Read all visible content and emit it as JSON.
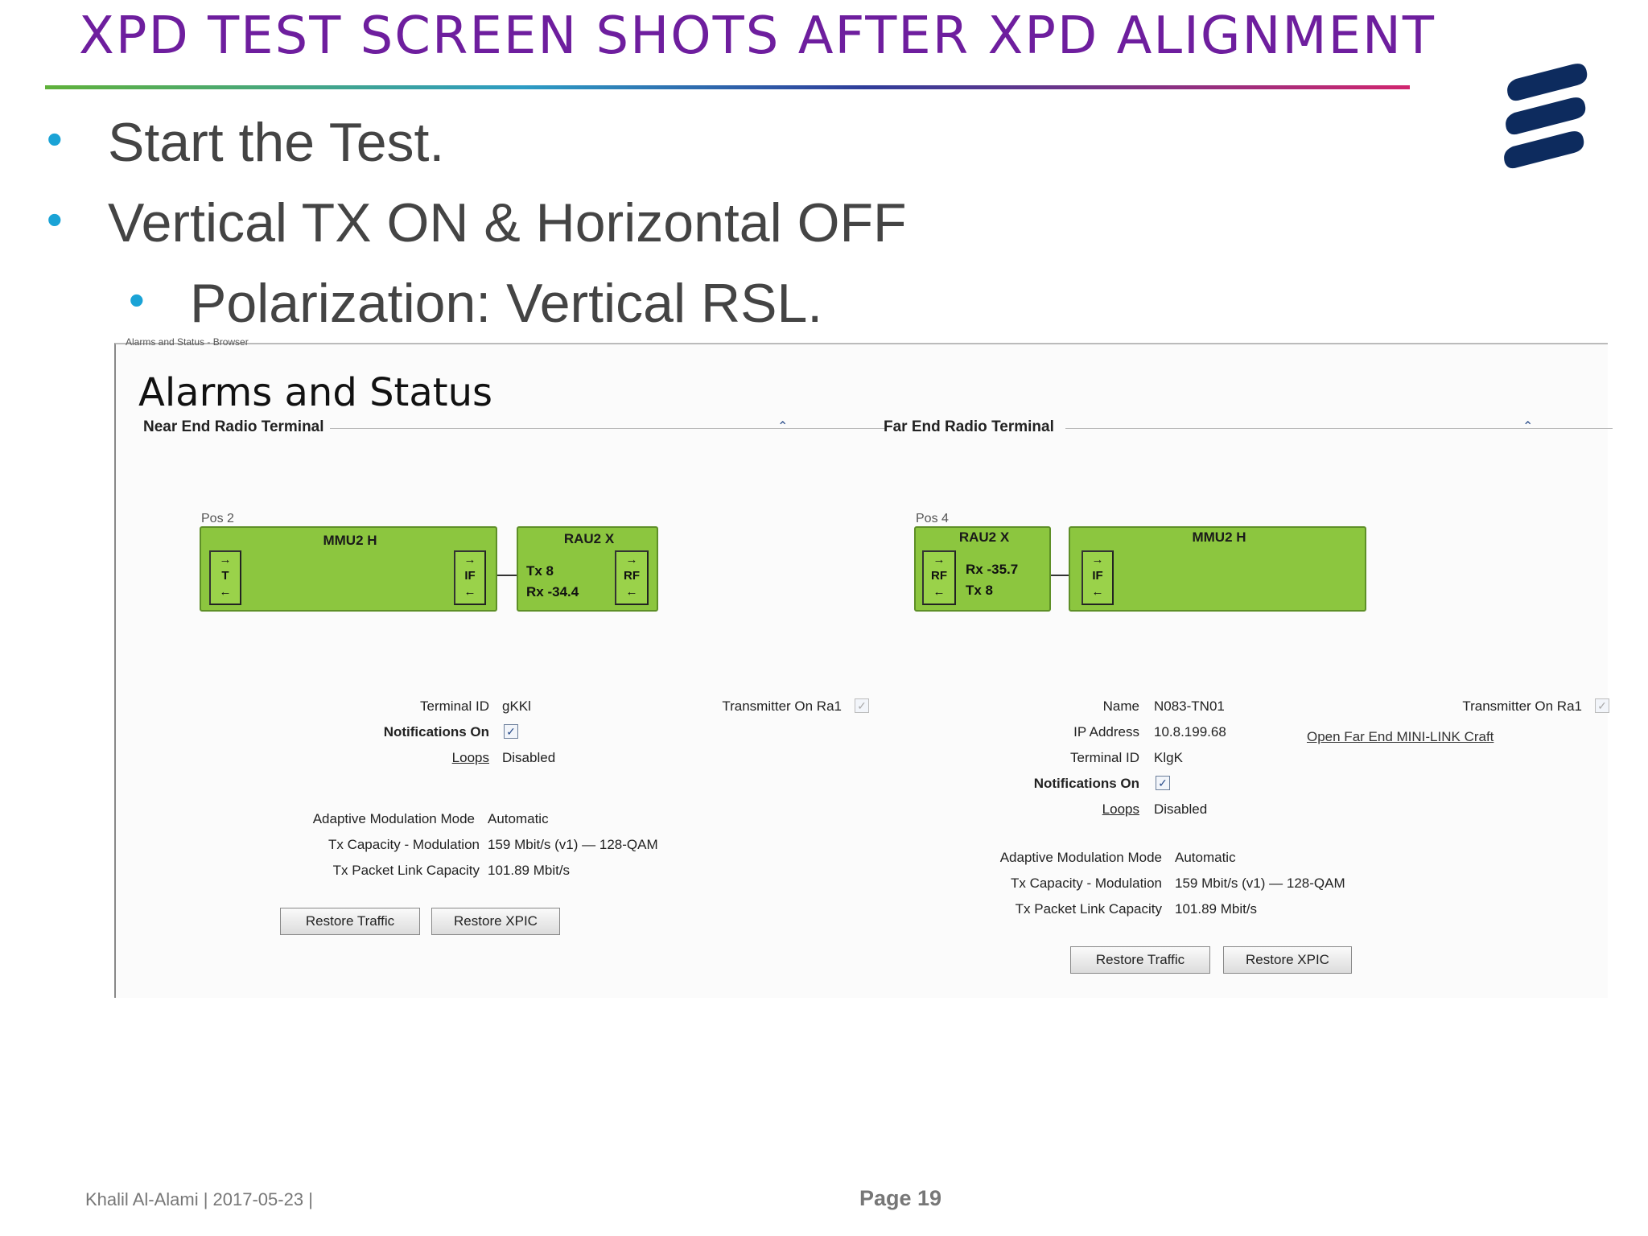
{
  "slide": {
    "title": "XPD TEST SCREEN SHOTS  AFTER XPD ALIGNMENT",
    "bullets": [
      "Start the Test.",
      "Vertical TX ON & Horizontal OFF"
    ],
    "sub_bullets": [
      "Polarization: Vertical RSL."
    ],
    "bullet_glyph": "•",
    "footer": {
      "left": "Khalil Al-Alami |  2017-05-23  |",
      "page": "Page 19"
    },
    "colors": {
      "title": "#6e1e9e",
      "bullet": "#1aa3d6",
      "logo": "#0d2b5e"
    }
  },
  "window": {
    "caption": "Alarms and Status - Browser",
    "title": "Alarms and Status",
    "near_end": {
      "header": "Near End Radio Terminal",
      "pos": "Pos 2",
      "mmu": {
        "title": "MMU2 H",
        "port_left": "T",
        "port_right": "IF"
      },
      "rau": {
        "title": "RAU2 X",
        "tx": "Tx  8",
        "rx": "Rx  -34.4",
        "port": "RF"
      },
      "fields": [
        {
          "label": "Terminal ID",
          "value": "gKKl"
        },
        {
          "label": "Notifications On",
          "value": "✓"
        },
        {
          "label": "Loops",
          "value": "Disabled"
        }
      ],
      "transmitter": {
        "label": "Transmitter On Ra1",
        "value": "✓"
      },
      "modulation": [
        {
          "label": "Adaptive Modulation Mode",
          "value": "Automatic"
        },
        {
          "label": "Tx Capacity - Modulation",
          "value": "159 Mbit/s (v1) — 128-QAM"
        },
        {
          "label": "Tx Packet Link Capacity",
          "value": "101.89 Mbit/s"
        }
      ],
      "buttons": [
        "Restore Traffic",
        "Restore XPIC"
      ]
    },
    "far_end": {
      "header": "Far End Radio Terminal",
      "pos": "Pos 4",
      "rau": {
        "title": "RAU2 X",
        "rx": "Rx  -35.7",
        "tx": "Tx  8",
        "port": "RF"
      },
      "mmu": {
        "title": "MMU2 H",
        "port_left": "IF"
      },
      "fields": [
        {
          "label": "Name",
          "value": "N083-TN01"
        },
        {
          "label": "IP Address",
          "value": "10.8.199.68"
        },
        {
          "label": "Terminal ID",
          "value": "KlgK"
        },
        {
          "label": "Notifications On",
          "value": "✓"
        },
        {
          "label": "Loops",
          "value": "Disabled"
        }
      ],
      "transmitter": {
        "label": "Transmitter On Ra1",
        "value": "✓"
      },
      "link": "Open Far End MINI-LINK Craft",
      "modulation": [
        {
          "label": "Adaptive Modulation Mode",
          "value": "Automatic"
        },
        {
          "label": "Tx Capacity - Modulation",
          "value": "159 Mbit/s (v1) — 128-QAM"
        },
        {
          "label": "Tx Packet Link Capacity",
          "value": "101.89 Mbit/s"
        }
      ],
      "buttons": [
        "Restore Traffic",
        "Restore XPIC"
      ]
    },
    "icons": {
      "collapse": "chevron-up-icon",
      "arrow_right": "→",
      "arrow_left": "←"
    }
  }
}
